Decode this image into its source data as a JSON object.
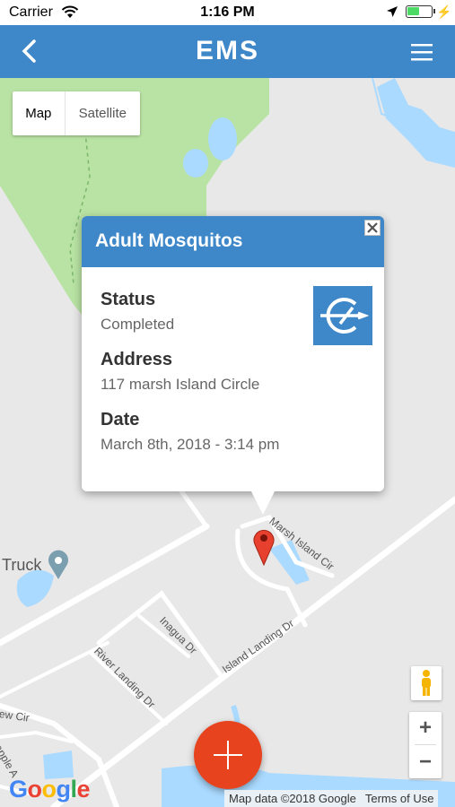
{
  "status_bar": {
    "carrier": "Carrier",
    "time": "1:16 PM",
    "battery_level": 0.5
  },
  "nav": {
    "title": "EMS",
    "back_icon": "chevron-left-icon",
    "menu_icon": "hamburger-menu-icon"
  },
  "map_type": {
    "map_label": "Map",
    "satellite_label": "Satellite"
  },
  "popup": {
    "title": "Adult Mosquitos",
    "status_label": "Status",
    "status_value": "Completed",
    "address_label": "Address",
    "address_value": "117 marsh Island Circle",
    "date_label": "Date",
    "date_value": "March 8th, 2018 - 3:14 pm"
  },
  "map_labels": {
    "poi": "Truck",
    "marsh_island_cir": "Marsh Island Cir",
    "island_landing_dr": "Island Landing Dr",
    "inagua_dr": "Inagua Dr",
    "river_landing_dr": "River Landing Dr",
    "view_cir": "ew Cir",
    "pineapple": "eapple A"
  },
  "controls": {
    "zoom_in": "+",
    "zoom_out": "−"
  },
  "attribution": {
    "logo": "Google",
    "map_data": "Map data ©2018 Google",
    "terms": "Terms of Use"
  },
  "colors": {
    "brand": "#3e87c8",
    "fab": "#e8431f",
    "park": "#b9e3a4",
    "water": "#aadaff"
  }
}
